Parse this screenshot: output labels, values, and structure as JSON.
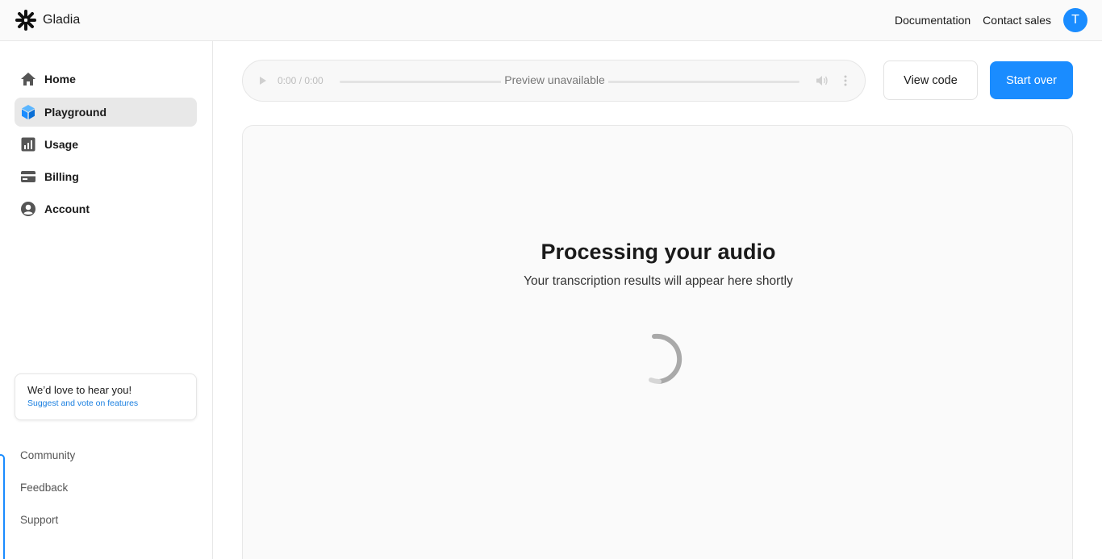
{
  "brand": {
    "name": "Gladia"
  },
  "header": {
    "documentation": "Documentation",
    "contact_sales": "Contact sales",
    "avatar_initial": "T"
  },
  "sidebar": {
    "items": [
      {
        "label": "Home",
        "icon": "home-icon",
        "active": false
      },
      {
        "label": "Playground",
        "icon": "cube-icon",
        "active": true
      },
      {
        "label": "Usage",
        "icon": "bar-chart-icon",
        "active": false
      },
      {
        "label": "Billing",
        "icon": "credit-card-icon",
        "active": false
      },
      {
        "label": "Account",
        "icon": "user-circle-icon",
        "active": false
      }
    ],
    "feedback_card": {
      "title": "We’d love to hear you!",
      "link": "Suggest and vote on features"
    },
    "bottom_links": [
      "Community",
      "Feedback",
      "Support"
    ]
  },
  "player": {
    "time": "0:00 / 0:00",
    "status": "Preview unavailable"
  },
  "toolbar": {
    "view_code": "View code",
    "start_over": "Start over"
  },
  "main": {
    "title": "Processing your audio",
    "subtitle": "Your transcription results will appear here shortly"
  },
  "colors": {
    "accent": "#1a8cff",
    "active_nav_bg": "#e8e8e8",
    "link": "#1a7fe0"
  }
}
